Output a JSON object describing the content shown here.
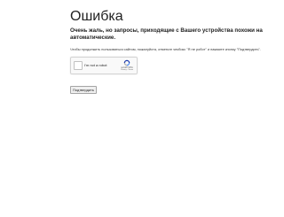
{
  "page": {
    "title": "Ошибка",
    "message": "Очень жаль, но запросы, приходящие с Вашего устройства похожи на автоматические.",
    "instructions": "Чтобы продолжить пользоваться сайтом, пожалуйста, отметьте чекбокс \"Я не робот\" и нажмите кнопку \"Подтвердить\"."
  },
  "captcha": {
    "label": "I'm not a robot",
    "brand": "reCAPTCHA",
    "links": "Privacy - Terms",
    "logo_icon": "recaptcha-logo-icon",
    "checked": false
  },
  "form": {
    "submit_label": "Подтвердить"
  }
}
